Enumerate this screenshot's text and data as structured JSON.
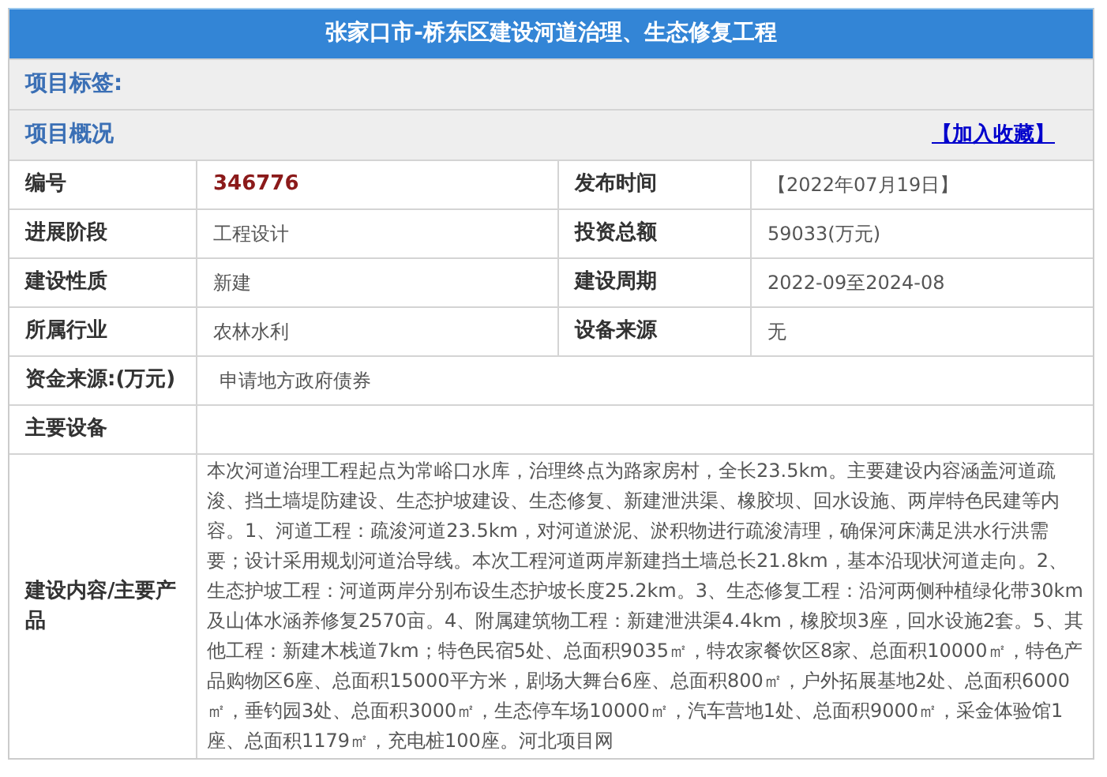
{
  "title": "张家口市-桥东区建设河道治理、生态修复工程",
  "tags_label": "项目标签:",
  "overview": {
    "label": "项目概况",
    "favorite_link": "【加入收藏】"
  },
  "pair_rows": [
    [
      {
        "label": "编号",
        "value": "346776",
        "kind": "number"
      },
      {
        "label": "发布时间",
        "value": "【2022年07月19日】",
        "kind": "text"
      }
    ],
    [
      {
        "label": "进展阶段",
        "value": "工程设计",
        "kind": "text"
      },
      {
        "label": "投资总额",
        "value": "59033(万元)",
        "kind": "text"
      }
    ],
    [
      {
        "label": "建设性质",
        "value": "新建",
        "kind": "text"
      },
      {
        "label": "建设周期",
        "value": "2022-09至2024-08",
        "kind": "text"
      }
    ],
    [
      {
        "label": "所属行业",
        "value": "农林水利",
        "kind": "text"
      },
      {
        "label": "设备来源",
        "value": "无",
        "kind": "text"
      }
    ]
  ],
  "wide_rows": [
    {
      "label": "资金来源:(万元)",
      "value": "申请地方政府债券"
    },
    {
      "label": "主要设备"
    },
    {
      "label": "建设内容/主要产品",
      "value": "本次河道治理工程起点为常峪口水库，治理终点为路家房村，全长23.5km。主要建设内容涵盖河道疏浚、挡土墙堤防建设、生态护坡建设、生态修复、新建泄洪渠、橡胶坝、回水设施、两岸特色民建等内容。1、河道工程：疏浚河道23.5km，对河道淤泥、淤积物进行疏浚清理，确保河床满足洪水行洪需要；设计采用规划河道治导线。本次工程河道两岸新建挡土墙总长21.8km，基本沿现状河道走向。2、生态护坡工程：河道两岸分别布设生态护坡长度25.2km。3、生态修复工程：沿河两侧种植绿化带30km及山体水涵养修复2570亩。4、附属建筑物工程：新建泄洪渠4.4km，橡胶坝3座，回水设施2套。5、其他工程：新建木栈道7km；特色民宿5处、总面积9035㎡，特农家餐饮区8家、总面积10000㎡，特色产品购物区6座、总面积15000平方米，剧场大舞台6座、总面积800㎡，户外拓展基地2处、总面积6000㎡，垂钓园3处、总面积3000㎡，生态停车场10000㎡，汽车营地1处、总面积9000㎡，采金体验馆1座、总面积1179㎡，充电桩100座。河北项目网"
    }
  ]
}
